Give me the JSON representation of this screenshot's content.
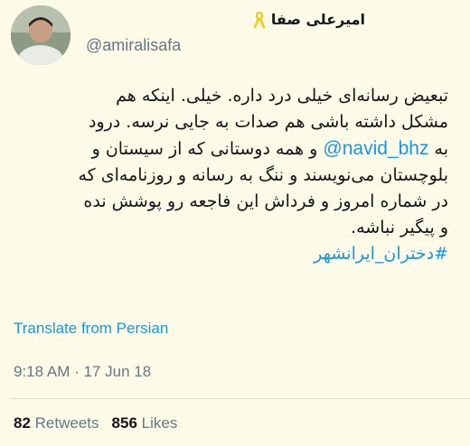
{
  "author": {
    "display_name": "امیرعلی صفا",
    "handle": "@amiralisafa",
    "badge_icon": "yellow-ribbon-icon",
    "avatar_icon": "profile-photo"
  },
  "tweet": {
    "line1": "تبعیض رسانه‌ای خیلی درد داره. خیلی. اینکه هم",
    "line2": "مشکل داشته باشی هم صدات به جایی نرسه. درود",
    "line3_prefix": "به",
    "mention": "@navid_bhz",
    "line3_suffix": "و همه دوستانی که از سیستان و",
    "line4": "بلوچستان می‌نویسند و ننگ به رسانه و روزنامه‌ای که",
    "line5": "در شماره امروز و فرداش این فاجعه رو پوشش نده",
    "line6": "و پیگیر نباشه.",
    "hashtag": "#دختران_ایرانشهر"
  },
  "translate_label": "Translate from Persian",
  "timestamp": "9:18 AM · 17 Jun 18",
  "stats": {
    "retweets_count": "82",
    "retweets_label": "Retweets",
    "likes_count": "856",
    "likes_label": "Likes"
  },
  "colors": {
    "background": "#fdfbe7",
    "link": "#1b95e0",
    "muted": "#657786",
    "ribbon": "#f5c518"
  }
}
